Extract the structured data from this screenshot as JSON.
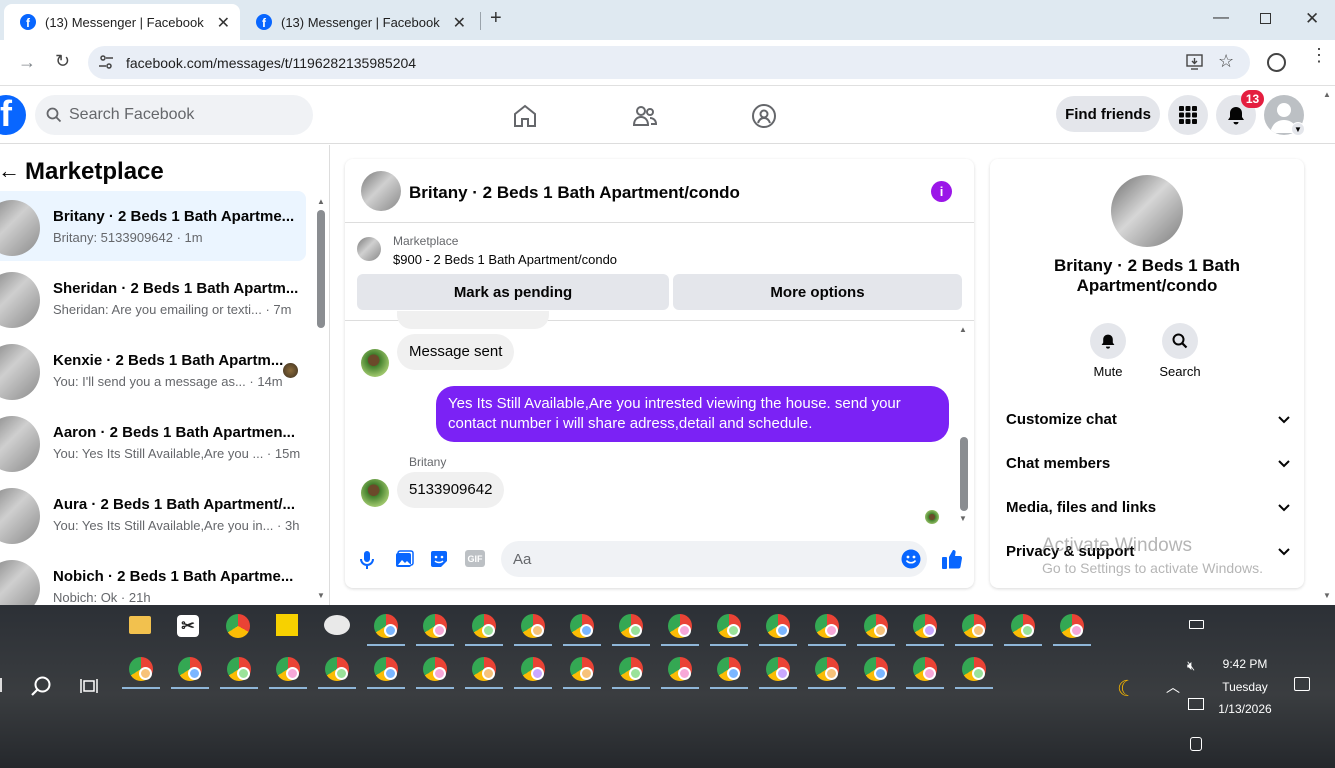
{
  "browser": {
    "tabs": [
      {
        "title": "(13) Messenger | Facebook",
        "active": true
      },
      {
        "title": "(13) Messenger | Facebook",
        "active": false
      }
    ],
    "url": "facebook.com/messages/t/1196282135985204"
  },
  "fb": {
    "search_placeholder": "Search Facebook",
    "find_friends": "Find friends",
    "notification_count": "13"
  },
  "left": {
    "title": "Marketplace",
    "conversations": [
      {
        "name": "Britany · 2 Beds 1 Bath Apartme...",
        "last": "Britany: 5133909642 · 1m"
      },
      {
        "name": "Sheridan · 2 Beds 1 Bath Apartm...",
        "last": "Sheridan: Are you emailing or texti... · 7m"
      },
      {
        "name": "Kenxie · 2 Beds 1 Bath Apartm...",
        "last": "You: I'll send you a message as... · 14m"
      },
      {
        "name": "Aaron · 2 Beds 1 Bath Apartmen...",
        "last": "You: Yes Its Still Available,Are you ... · 15m"
      },
      {
        "name": "Aura · 2 Beds 1 Bath Apartment/...",
        "last": "You: Yes Its Still Available,Are you in... · 3h"
      },
      {
        "name": "Nobich · 2 Beds 1 Bath Apartme...",
        "last": "Nobich: Ok · 21h"
      }
    ]
  },
  "chat": {
    "header_title": "Britany · 2 Beds 1 Bath Apartment/condo",
    "listing_source": "Marketplace",
    "listing_title": "$900 - 2 Beds 1 Bath Apartment/condo",
    "btn_pending": "Mark as pending",
    "btn_more": "More options",
    "msg1": "Message sent",
    "msg2": "Yes Its Still Available,Are you intrested viewing the house. send your contact number i will share adress,detail and schedule.",
    "sender": "Britany",
    "msg3": "5133909642",
    "input_placeholder": "Aa"
  },
  "info": {
    "name": "Britany · 2 Beds 1 Bath Apartment/condo",
    "mute": "Mute",
    "search": "Search",
    "sections": [
      "Customize chat",
      "Chat members",
      "Media, files and links",
      "Privacy & support"
    ]
  },
  "watermark": {
    "line1": "Activate Windows",
    "line2": "Go to Settings to activate Windows."
  },
  "taskbar": {
    "time": "9:42 PM",
    "day": "Tuesday",
    "date": "1/13/2026"
  },
  "colors": {
    "accent": "#0866ff",
    "outgoing_bubble": "#7b22f5",
    "incoming_bubble": "#f0f0f0",
    "notification_badge": "#e41e3f"
  }
}
